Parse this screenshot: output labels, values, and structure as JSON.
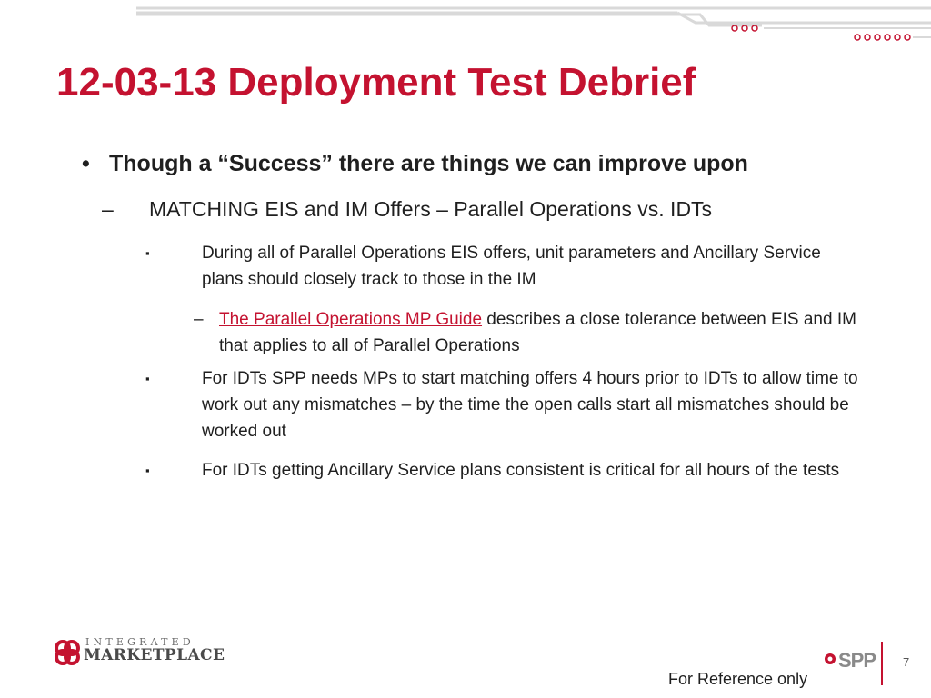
{
  "slide": {
    "title": "12-03-13 Deployment Test Debrief",
    "bullet1": {
      "marker": "•",
      "text": "Though a “Success” there are things we can improve upon"
    },
    "bullet2": {
      "marker": "–",
      "text": "MATCHING EIS and IM Offers – Parallel Operations vs. IDTs"
    },
    "bullet3a": {
      "marker": "▪",
      "text": "During all of Parallel Operations EIS offers, unit parameters and Ancillary Service plans should closely track to those in the IM"
    },
    "bullet4": {
      "marker": "–",
      "link_text": "The Parallel Operations MP Guide",
      "text": " describes a close tolerance between EIS and IM that applies to all of Parallel Operations"
    },
    "bullet3b": {
      "marker": "▪",
      "text": "For IDTs SPP needs MPs to start matching offers 4 hours prior to IDTs to allow time to work out any mismatches – by the time the open calls start all mismatches should be worked out"
    },
    "bullet3c": {
      "marker": "▪",
      "text": "For IDTs getting Ancillary Service plans consistent is critical for all hours of the tests"
    }
  },
  "footer": {
    "logo_top": "INTEGRATED",
    "logo_bottom": "MARKETPLACE",
    "spp_logo": "SPP",
    "page_number": "7",
    "note": "For Reference only"
  },
  "colors": {
    "accent": "#c41230",
    "text": "#1f1f1f",
    "rule": "#d9d9d9"
  },
  "icons": {
    "header_decoration": "rule-lines-with-circles",
    "im_logo_mark": "four-ring-knot-logo",
    "spp_logo_mark": "spp-star-logo"
  }
}
